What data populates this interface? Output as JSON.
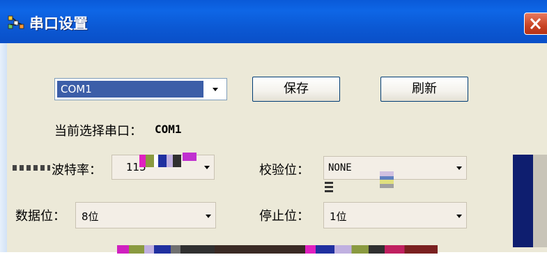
{
  "window": {
    "title": "串口设置",
    "close_label": "×"
  },
  "port": {
    "selected": "COM1",
    "current_label": "当前选择串口：",
    "current_value": "COM1"
  },
  "buttons": {
    "save": "保存",
    "refresh": "刷新"
  },
  "settings": {
    "baud_label": "波特率：",
    "baud_value": "115",
    "parity_label": "校验位：",
    "parity_value": "NONE",
    "databits_label": "数据位：",
    "databits_value": "8位",
    "stopbits_label": "停止位：",
    "stopbits_value": "1位"
  },
  "colors": {
    "title_bar": "#0a5ad8",
    "client_bg": "#ece9d8",
    "selection": "#3c5ea8",
    "close_button": "#c94324"
  }
}
